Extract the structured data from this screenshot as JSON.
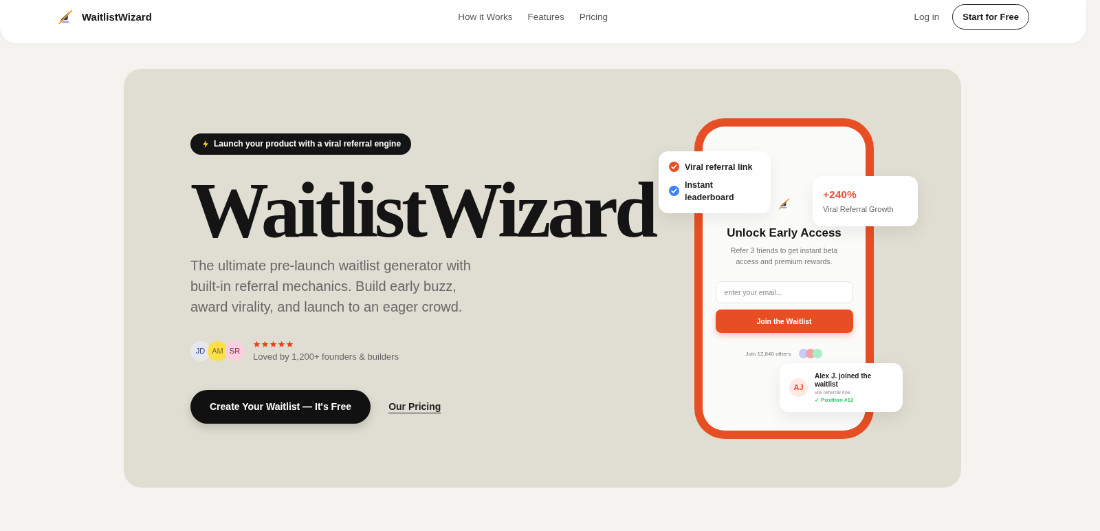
{
  "nav": {
    "brand": "WaitlistWizard",
    "links": [
      {
        "label": "How it Works"
      },
      {
        "label": "Features"
      },
      {
        "label": "Pricing"
      }
    ],
    "login": "Log in",
    "cta": "Start for Free"
  },
  "hero": {
    "badge": "Launch your product with a viral referral engine",
    "title": "WaitlistWizard",
    "description": "The ultimate pre-launch waitlist generator with built-in referral mechanics. Build early buzz, award virality, and launch to an eager crowd.",
    "social_proof": {
      "avatars": [
        {
          "initials": "JD",
          "color": "#e6e8f0"
        },
        {
          "initials": "AM",
          "color": "#fde047"
        },
        {
          "initials": "SR",
          "color": "#fbcfe0"
        }
      ],
      "stars": 5,
      "caption": "Loved by 1,200+ founders & builders"
    },
    "cta": "Create Your Waitlist — It's Free",
    "secondary_link": "Our Pricing"
  },
  "phone": {
    "heading": "Unlock Early Access",
    "subtitle": "Refer 3 friends to get instant beta access and premium rewards.",
    "email_field": {
      "placeholder": "enter your email..."
    },
    "button": "Join the Waitlist",
    "social_proof": {
      "text": "Join 12,840 others",
      "dots": [
        {
          "color": "#c7cbf7"
        },
        {
          "color": "#f4a4a4"
        },
        {
          "color": "#a7efc6"
        }
      ]
    }
  },
  "feature_card": {
    "items": [
      {
        "label": "Viral referral link",
        "checked": true,
        "color": "#e84e23"
      },
      {
        "label": "Instant leaderboard",
        "checked": true,
        "color": "#3b82f6"
      }
    ]
  },
  "stat_card": {
    "value": "+240%",
    "label": "Viral Referral Growth"
  },
  "notification": {
    "initials": "AJ",
    "title": "Alex J. joined the waitlist",
    "detail": "via referral link",
    "position": "✓ Position #12"
  }
}
